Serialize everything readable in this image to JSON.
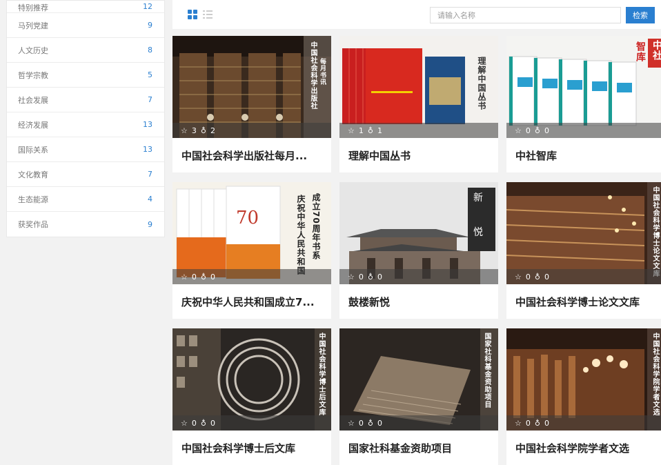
{
  "sidebar": {
    "items": [
      {
        "label": "特别推荐",
        "count": "12"
      },
      {
        "label": "马列党建",
        "count": "9"
      },
      {
        "label": "人文历史",
        "count": "8"
      },
      {
        "label": "哲学宗教",
        "count": "5"
      },
      {
        "label": "社会发展",
        "count": "7"
      },
      {
        "label": "经济发展",
        "count": "13"
      },
      {
        "label": "国际关系",
        "count": "13"
      },
      {
        "label": "文化教育",
        "count": "7"
      },
      {
        "label": "生态能源",
        "count": "4"
      },
      {
        "label": "获奖作品",
        "count": "9"
      }
    ]
  },
  "toolbar": {
    "search_placeholder": "请输入名称",
    "search_button": "检索"
  },
  "cards": [
    {
      "title": "中国社会科学出版社每月...",
      "stars": "3",
      "likes": "2",
      "cover_text": [
        "中国社会科学出版社",
        "每月书讯"
      ]
    },
    {
      "title": "理解中国丛书",
      "stars": "1",
      "likes": "1",
      "cover_text": [
        "理解中国丛书"
      ]
    },
    {
      "title": "中社智库",
      "stars": "0",
      "likes": "0",
      "cover_text": [
        "中社",
        "智库"
      ]
    },
    {
      "title": "庆祝中华人民共和国成立7...",
      "stars": "0",
      "likes": "0",
      "cover_text": [
        "成立70周年书系",
        "庆祝中华人民共和国"
      ]
    },
    {
      "title": "鼓楼新悦",
      "stars": "0",
      "likes": "0",
      "cover_text": [
        "新",
        "悦"
      ]
    },
    {
      "title": "中国社会科学博士论文文库",
      "stars": "0",
      "likes": "0",
      "cover_text": [
        "中国社会科学博士论文文库"
      ]
    },
    {
      "title": "中国社会科学博士后文库",
      "stars": "0",
      "likes": "0",
      "cover_text": [
        "中国社会科学博士后文库"
      ]
    },
    {
      "title": "国家社科基金资助项目",
      "stars": "0",
      "likes": "0",
      "cover_text": [
        "国家社科基金资助项目"
      ]
    },
    {
      "title": "中国社会科学院学者文选",
      "stars": "0",
      "likes": "0",
      "cover_text": [
        "中国社会科学院学者文选"
      ]
    }
  ],
  "icons": {
    "star": "☆",
    "like": "♁"
  },
  "colors": {
    "accent": "#2a7fd0",
    "count": "#2a7fd0"
  }
}
